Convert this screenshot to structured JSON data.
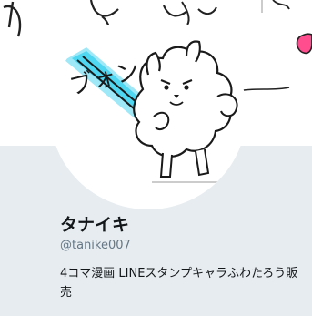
{
  "profile": {
    "display_name": "タナイキ",
    "handle": "@tanike007",
    "bio": "4コマ漫画 LINEスタンプキャラふわたろう販売"
  },
  "avatar": {
    "sound_effect": "ブォン"
  },
  "colors": {
    "background": "#e6ecf0",
    "text": "#14171a",
    "secondary_text": "#657786",
    "saber_blue": "#4fd6f0",
    "banner_accent": "#ff4d8d"
  },
  "icons": {
    "meta": "calendar-icon"
  }
}
